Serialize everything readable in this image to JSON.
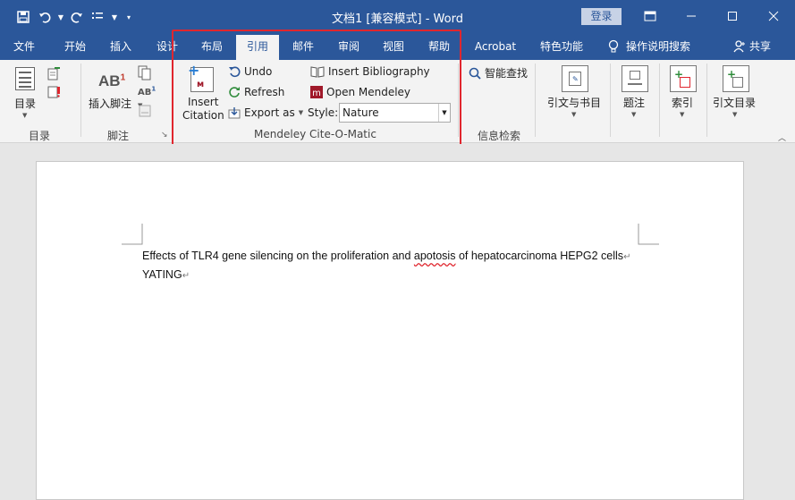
{
  "titlebar": {
    "title": "文档1 [兼容模式]  -  Word",
    "login_label": "登录",
    "accent": "#2b579a"
  },
  "tabs": [
    {
      "label": "文件"
    },
    {
      "label": "开始"
    },
    {
      "label": "插入"
    },
    {
      "label": "设计"
    },
    {
      "label": "布局"
    },
    {
      "label": "引用",
      "active": true
    },
    {
      "label": "邮件"
    },
    {
      "label": "审阅"
    },
    {
      "label": "视图"
    },
    {
      "label": "帮助"
    },
    {
      "label": "Acrobat"
    },
    {
      "label": "特色功能"
    }
  ],
  "tell_me": "操作说明搜索",
  "share": "共享",
  "ribbon": {
    "toc": {
      "button": "目录",
      "group": "目录"
    },
    "footnotes": {
      "insert_footnote": "插入脚注",
      "group": "脚注"
    },
    "mendeley": {
      "insert_citation_line1": "Insert",
      "insert_citation_line2": "Citation",
      "undo": "Undo",
      "refresh": "Refresh",
      "export_as": "Export as",
      "insert_bibliography": "Insert Bibliography",
      "open_mendeley": "Open Mendeley",
      "style_label": "Style:",
      "style_value": "Nature",
      "group": "Mendeley Cite-O-Matic"
    },
    "research": {
      "smart_lookup": "智能查找",
      "group": "信息检索"
    },
    "citations": {
      "button": "引文与书目"
    },
    "captions": {
      "button": "题注"
    },
    "index": {
      "button": "索引"
    },
    "toa": {
      "button": "引文目录"
    }
  },
  "document": {
    "line1": "Effects of TLR4 gene silencing on the proliferation and ",
    "line1_misspelled": "apotosis",
    "line1_rest": " of hepatocarcinoma HEPG2 cells",
    "line2": "YATING",
    "para_mark": "↵"
  },
  "colors": {
    "highlight": "#e0262e",
    "mendeley_red": "#a0192a"
  }
}
